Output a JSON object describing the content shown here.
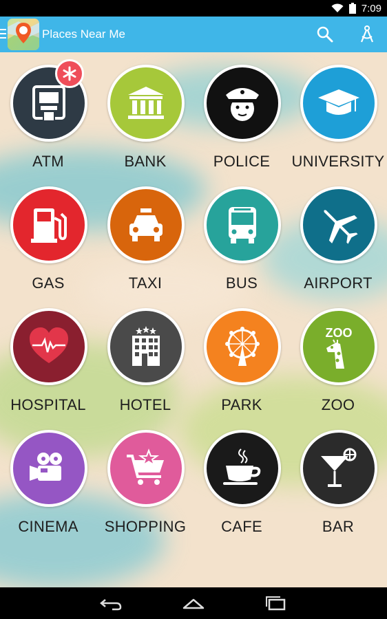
{
  "status_bar": {
    "time": "7:09"
  },
  "header": {
    "title": "Places Near Me"
  },
  "categories": [
    {
      "label": "ATM",
      "color": "#2e3a45",
      "icon": "atm-icon"
    },
    {
      "label": "BANK",
      "color": "#a6c83a",
      "icon": "bank-icon"
    },
    {
      "label": "POLICE",
      "color": "#111111",
      "icon": "police-icon"
    },
    {
      "label": "UNIVERSITY",
      "color": "#1e9fd7",
      "icon": "graduation-cap-icon"
    },
    {
      "label": "GAS",
      "color": "#e3262d",
      "icon": "gas-pump-icon"
    },
    {
      "label": "TAXI",
      "color": "#d8650c",
      "icon": "taxi-icon"
    },
    {
      "label": "BUS",
      "color": "#27a39b",
      "icon": "bus-icon"
    },
    {
      "label": "AIRPORT",
      "color": "#0f6f8a",
      "icon": "airplane-icon"
    },
    {
      "label": "HOSPITAL",
      "color": "#8a1f2f",
      "icon": "heart-icon"
    },
    {
      "label": "HOTEL",
      "color": "#4a4a4a",
      "icon": "hotel-icon"
    },
    {
      "label": "PARK",
      "color": "#f4821f",
      "icon": "ferris-wheel-icon"
    },
    {
      "label": "ZOO",
      "color": "#7aae2b",
      "icon": "giraffe-icon"
    },
    {
      "label": "CINEMA",
      "color": "#9556c4",
      "icon": "movie-camera-icon"
    },
    {
      "label": "SHOPPING",
      "color": "#e05b9b",
      "icon": "shopping-cart-icon"
    },
    {
      "label": "CAFE",
      "color": "#1a1a1a",
      "icon": "coffee-cup-icon"
    },
    {
      "label": "BAR",
      "color": "#2b2b2b",
      "icon": "cocktail-icon"
    }
  ],
  "zoo_sign": "ZOO",
  "badge_color": "#ef4e5a",
  "accent_color": "#3fb6e8"
}
